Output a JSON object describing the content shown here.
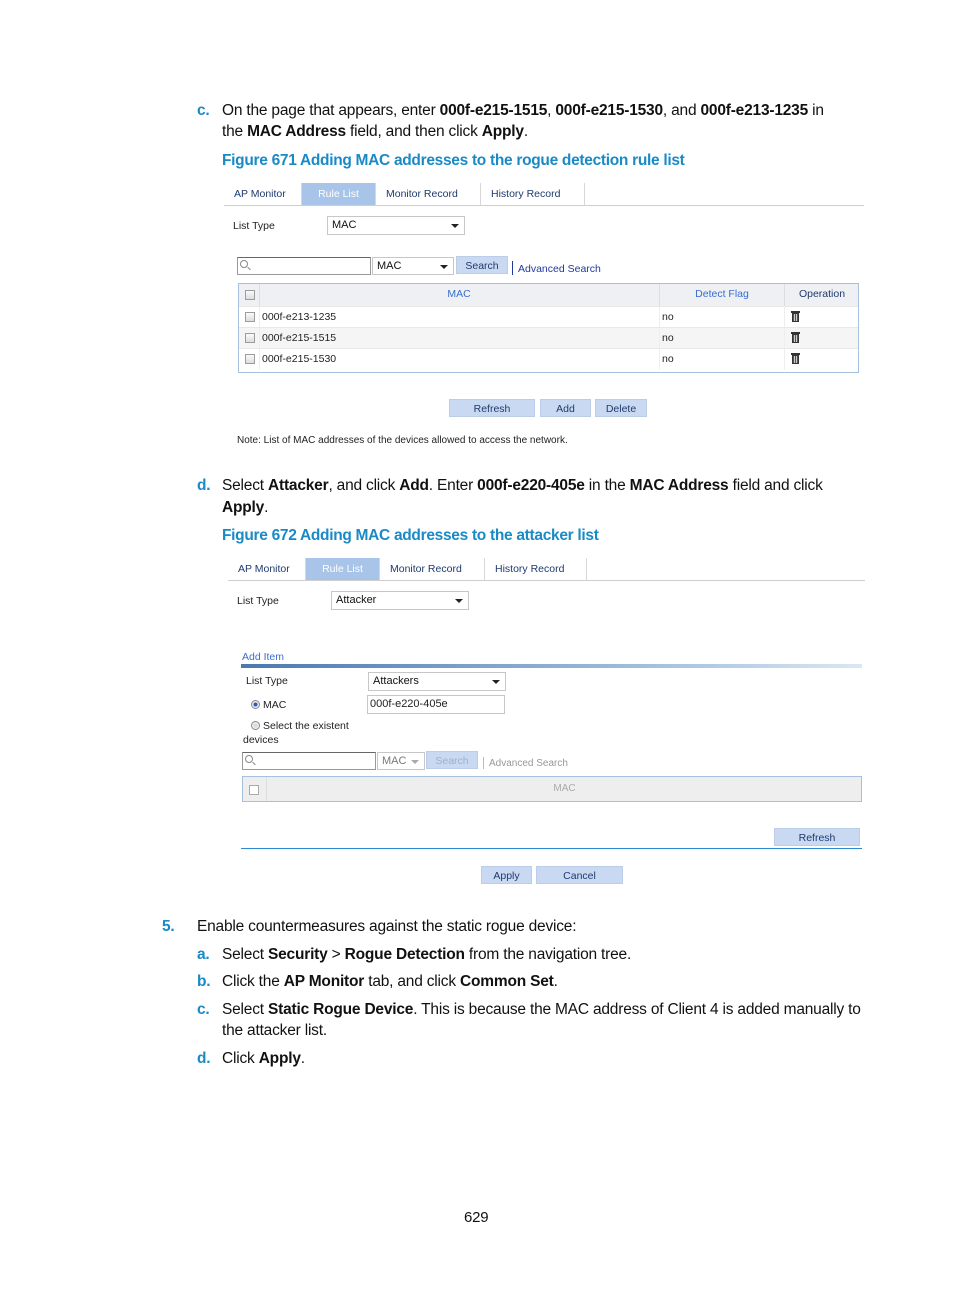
{
  "steps": {
    "c1": {
      "marker": "c.",
      "line1_parts": [
        "On the page that appears, enter ",
        "000f-e215-1515",
        ", ",
        "000f-e215-1530",
        ", and ",
        "000f-e213-1235",
        " in"
      ],
      "line2_parts": [
        "the ",
        "MAC Address",
        " field, and then click ",
        "Apply",
        "."
      ]
    },
    "d1": {
      "marker": "d.",
      "line1_parts": [
        "Select ",
        "Attacker",
        ", and click ",
        "Add",
        ". Enter ",
        "000f-e220-405e",
        " in the ",
        "MAC Address",
        " field and click"
      ],
      "line2_parts": [
        "Apply",
        "."
      ]
    },
    "step5": {
      "marker": "5.",
      "text": "Enable countermeasures against the static rogue device:"
    },
    "a": {
      "marker": "a.",
      "parts": [
        "Select ",
        "Security",
        " > ",
        "Rogue Detection",
        " from the navigation tree."
      ]
    },
    "b": {
      "marker": "b.",
      "parts": [
        "Click the ",
        "AP Monitor",
        " tab, and click ",
        "Common Set",
        "."
      ]
    },
    "c2": {
      "marker": "c.",
      "line1_parts": [
        "Select ",
        "Static Rogue Device",
        ". This is because the MAC address of Client 4 is added manually to"
      ],
      "line2": "the attacker list."
    },
    "d2": {
      "marker": "d.",
      "parts": [
        "Click ",
        "Apply",
        "."
      ]
    }
  },
  "figure671": {
    "caption": "Figure 671 Adding MAC addresses to the rogue detection rule list",
    "tabs": [
      "AP Monitor",
      "Rule List",
      "Monitor Record",
      "History Record"
    ],
    "active_tab": "Rule List",
    "list_type_label": "List Type",
    "list_type_value": "MAC",
    "search": {
      "input_value": "",
      "field_value": "MAC",
      "search_button": "Search",
      "advanced_link": "Advanced Search"
    },
    "table": {
      "headers": [
        "MAC",
        "Detect Flag",
        "Operation"
      ],
      "rows": [
        {
          "mac": "000f-e213-1235",
          "detect_flag": "no",
          "operation": "trash-icon"
        },
        {
          "mac": "000f-e215-1515",
          "detect_flag": "no",
          "operation": "trash-icon"
        },
        {
          "mac": "000f-e215-1530",
          "detect_flag": "no",
          "operation": "trash-icon"
        }
      ]
    },
    "buttons": {
      "refresh": "Refresh",
      "add": "Add",
      "delete": "Delete"
    },
    "note": "Note: List of MAC addresses of the devices allowed to access the network."
  },
  "figure672": {
    "caption": "Figure 672 Adding MAC addresses to the attacker list",
    "tabs": [
      "AP Monitor",
      "Rule List",
      "Monitor Record",
      "History Record"
    ],
    "active_tab": "Rule List",
    "list_type_label": "List Type",
    "list_type_value": "Attacker",
    "add_item": {
      "title": "Add Item",
      "list_type_label": "List Type",
      "list_type_value": "Attackers",
      "radio_mac_label": "MAC",
      "radio_mac_selected": true,
      "mac_value": "000f-e220-405e",
      "radio_existent_label_1": "Select the existent",
      "radio_existent_label_2": "devices",
      "search_field_value": "MAC",
      "search_button": "Search",
      "advanced_link": "Advanced Search",
      "table_header": "MAC",
      "refresh_button": "Refresh"
    },
    "buttons": {
      "apply": "Apply",
      "cancel": "Cancel"
    }
  },
  "page_number": "629",
  "colors": {
    "accent": "#1a8ac6",
    "tab_active": "#a8c4e8",
    "button_bg": "#c9d9f2"
  }
}
